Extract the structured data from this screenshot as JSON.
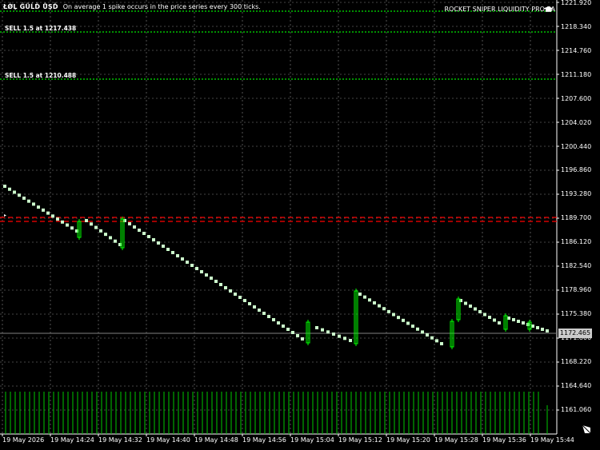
{
  "header": {
    "symbol_text": "ŁǾĻ ĜŨĹĎ ŮŞĎ",
    "spike_message": "On average 1 spike occurs in the price series every  300 ticks.",
    "ea_name": "ROCKET SNIPER LIQUIDITY PRO EA",
    "ea_icon": "graduation-cap-icon"
  },
  "orders": [
    {
      "label": "SELL 1.5 at 1217.438"
    },
    {
      "label": "SELL 1.5 at 1210.488"
    }
  ],
  "price_axis": {
    "labels": [
      "1221.920",
      "1218.340",
      "1214.760",
      "1211.180",
      "1207.600",
      "1204.020",
      "1200.440",
      "1196.860",
      "1193.280",
      "1189.700",
      "1186.120",
      "1182.540",
      "1178.960",
      "1175.380",
      "1171.800",
      "1168.220",
      "1164.640",
      "1161.060"
    ],
    "current_price": "1172.465"
  },
  "time_axis": {
    "labels": [
      "19 May 2026",
      "19 May 14:24",
      "19 May 14:32",
      "19 May 14:40",
      "19 May 14:48",
      "19 May 14:56",
      "19 May 15:04",
      "19 May 15:12",
      "19 May 15:20",
      "19 May 15:28",
      "19 May 15:36",
      "19 May 15:44"
    ]
  },
  "colors": {
    "background": "#000000",
    "grid": "#8a8a8a",
    "candle_bull": "#00ff00",
    "candle_bear": "#00ff00",
    "doji": "#ccffcc",
    "order_line": "#00c000",
    "bid_line": "#ff0000",
    "volume": "#00c800",
    "current_price_line": "#808080"
  }
}
